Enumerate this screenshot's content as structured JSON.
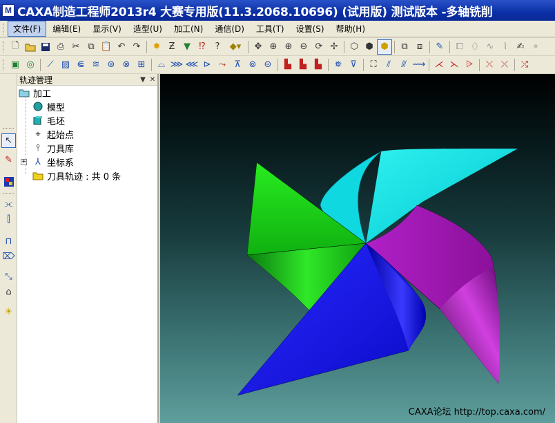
{
  "window": {
    "title": "CAXA制造工程师2013r4 大赛专用版(11.3.2068.10696) (试用版) 测试版本 -多轴铣削"
  },
  "menu": [
    "文件(F)",
    "编辑(E)",
    "显示(V)",
    "造型(U)",
    "加工(N)",
    "通信(D)",
    "工具(T)",
    "设置(S)",
    "帮助(H)"
  ],
  "toolbar1_icons": [
    "new-file-icon",
    "open-folder-icon",
    "save-icon",
    "print-icon",
    "cut-icon",
    "copy-icon",
    "paste-icon",
    "undo-icon",
    "redo-icon",
    "light-icon",
    "curve-tool-icon",
    "filter-icon",
    "edit-icon",
    "help-icon",
    "layer-dropdown-icon",
    "pan-icon",
    "zoom-window-icon",
    "zoom-in-icon",
    "zoom-out-icon",
    "rotate-icon",
    "move-icon",
    "wireframe-icon",
    "hidden-line-icon",
    "shaded-icon",
    "view-a-icon",
    "view-b-icon",
    "tool-icon",
    "face-a-icon",
    "face-b-icon",
    "face-c-icon",
    "face-d-icon",
    "face-e-icon",
    "face-f-icon"
  ],
  "toolbar2_icons": [
    "surface-a-icon",
    "surface-b-icon",
    "surface-c-icon",
    "surface-d-icon",
    "surface-e-icon",
    "surface-f-icon",
    "surface-g-icon",
    "surface-h-icon",
    "surface-i-icon",
    "surface-j-icon",
    "surface-k-icon",
    "surface-l-icon",
    "surface-m-icon",
    "surface-n-icon",
    "surface-o-icon",
    "surface-p-icon",
    "surface-q-icon",
    "surface-r-icon",
    "surface-s-icon",
    "surface-t-icon",
    "surface-u-icon",
    "surface-v-icon",
    "surface-w-icon",
    "surface-x-icon",
    "surface-y-icon",
    "surface-z-icon",
    "path-a-icon",
    "path-b-icon",
    "path-c-icon",
    "path-d-icon",
    "path-e-icon",
    "path-f-icon"
  ],
  "panel": {
    "title": "轨迹管理",
    "tree": {
      "root": "加工",
      "items": [
        "模型",
        "毛坯",
        "起始点",
        "刀具库",
        "坐标系",
        "刀具轨迹 : 共 0 条"
      ]
    }
  },
  "left_toolbar_icons": [
    "select-arrow-icon",
    "pencil-icon",
    "color-grid-icon",
    "trim-icon",
    "mirror-icon",
    "measure-icon",
    "fillet-icon",
    "scale-icon",
    "machine-icon",
    "light-bulb-icon"
  ],
  "viewport": {
    "watermark": "CAXA论坛 http://top.caxa.com/",
    "colors": {
      "cyan": "#00e5e5",
      "green": "#22e81e",
      "blue": "#1010f0",
      "purple": "#a01ab8"
    }
  }
}
